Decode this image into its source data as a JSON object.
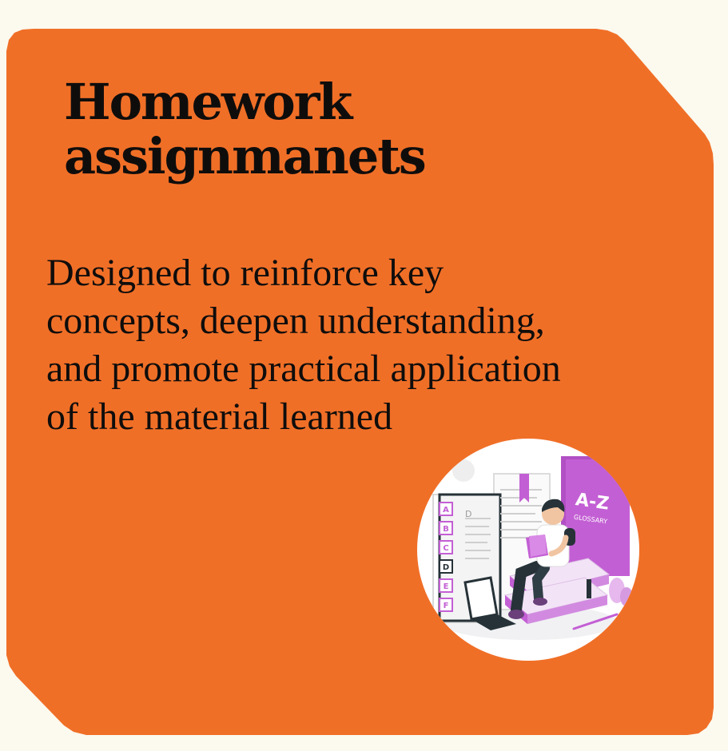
{
  "card": {
    "title": "Homework assignmanets",
    "description": "Designed to reinforce key concepts, deepen understanding, and promote practical application of the material learned",
    "background_color": "#f06f27"
  },
  "illustration": {
    "book_cover_text": "A-Z",
    "book_cover_subtext": "GLOSSARY",
    "index_tabs": [
      "A",
      "B",
      "C",
      "D",
      "E",
      "F"
    ],
    "page_letter": "D",
    "accent_color": "#c35fd4"
  }
}
